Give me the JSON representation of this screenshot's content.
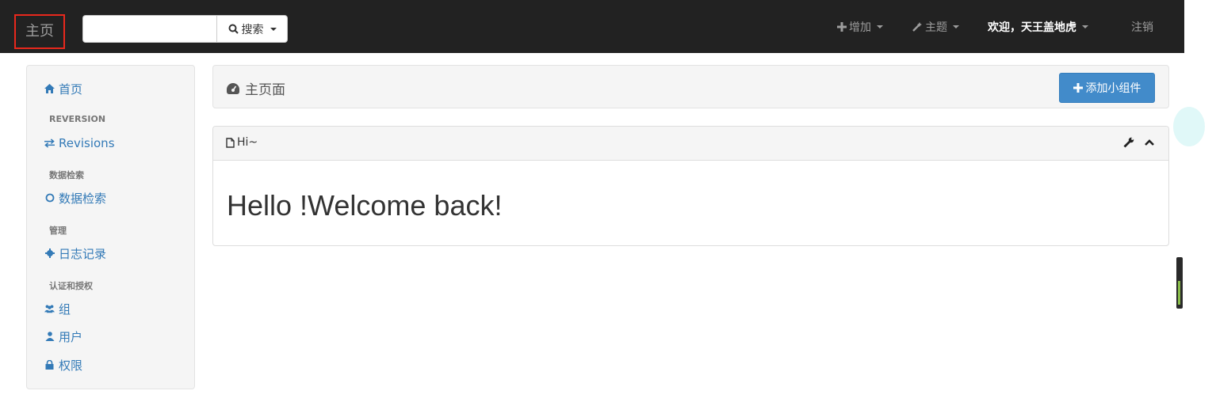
{
  "navbar": {
    "brand": "主页",
    "search": {
      "placeholder": "",
      "button_label": "搜索"
    },
    "add_label": "增加",
    "theme_label": "主题",
    "welcome_label": "欢迎，天王盖地虎",
    "logout_label": "注销"
  },
  "sidebar": {
    "home": "首页",
    "sections": [
      {
        "heading": "REVERSION",
        "item": "Revisions"
      },
      {
        "heading": "数据检索",
        "item": "数据检索"
      },
      {
        "heading": "管理",
        "item": "日志记录"
      },
      {
        "heading": "认证和授权",
        "items": [
          "组",
          "用户",
          "权限"
        ]
      }
    ]
  },
  "page": {
    "title": "主页面",
    "add_widget_label": "添加小组件"
  },
  "widget": {
    "title": "Hi~",
    "body": "Hello !Welcome back!"
  },
  "colors": {
    "navbar": "#222222",
    "link": "#337ab7",
    "primary_button": "#428bca",
    "brand_highlight": "#e8281d"
  }
}
